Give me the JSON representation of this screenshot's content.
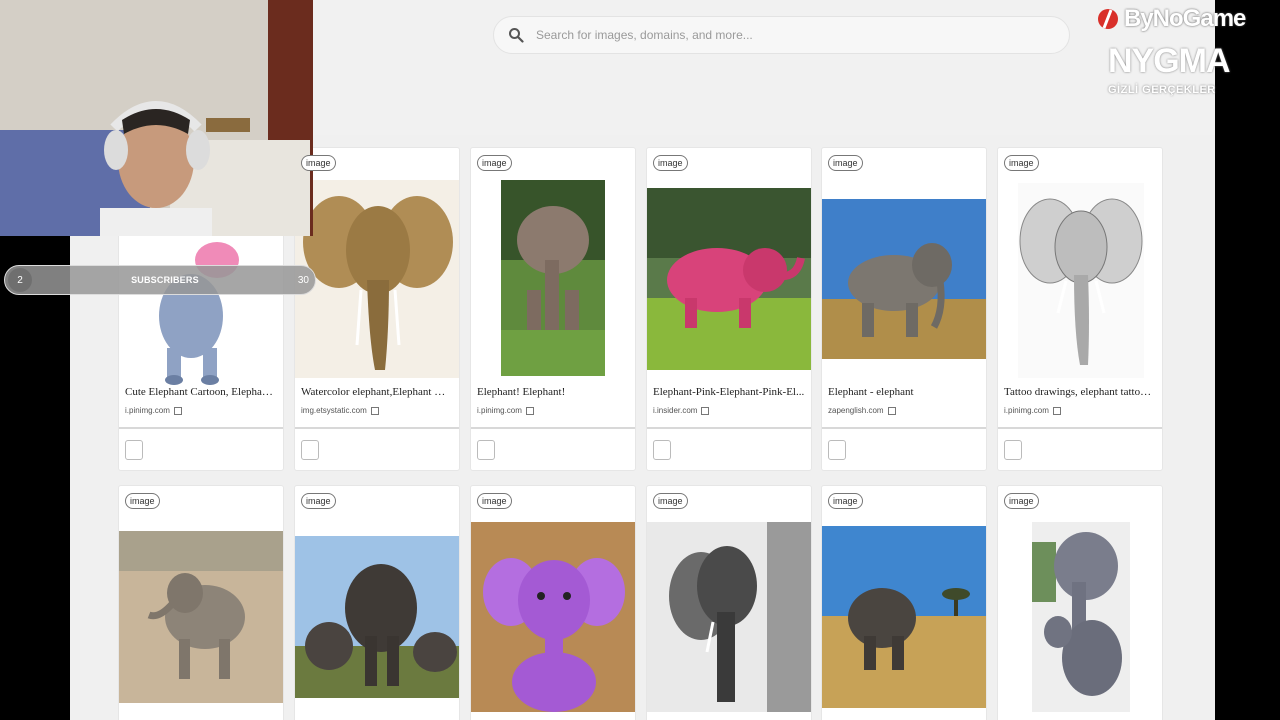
{
  "search": {
    "placeholder": "Search for images, domains, and more..."
  },
  "overlay": {
    "subscribers_label": "SUBSCRIBERS",
    "subscribers_left": "2",
    "subscribers_right": "30",
    "brand": "ByNoGame",
    "nygma": "NYGMA",
    "nygma_sub": "GİZLİ GERÇEKLER"
  },
  "badge_label": "image",
  "row1": [
    {
      "title": "Cute Elephant Cartoon, Elephant ...",
      "domain": "i.pinimg.com"
    },
    {
      "title": "Watercolor elephant,Elephant wa...",
      "domain": "img.etsystatic.com"
    },
    {
      "title": "Elephant! Elephant!",
      "domain": "i.pinimg.com"
    },
    {
      "title": "Elephant-Pink-Elephant-Pink-El...",
      "domain": "i.insider.com"
    },
    {
      "title": "Elephant - elephant",
      "domain": "zapenglish.com"
    },
    {
      "title": "Tattoo drawings, elephant tattoo ...",
      "domain": "i.pinimg.com"
    }
  ],
  "colors": {
    "accent": "#d9302a"
  }
}
